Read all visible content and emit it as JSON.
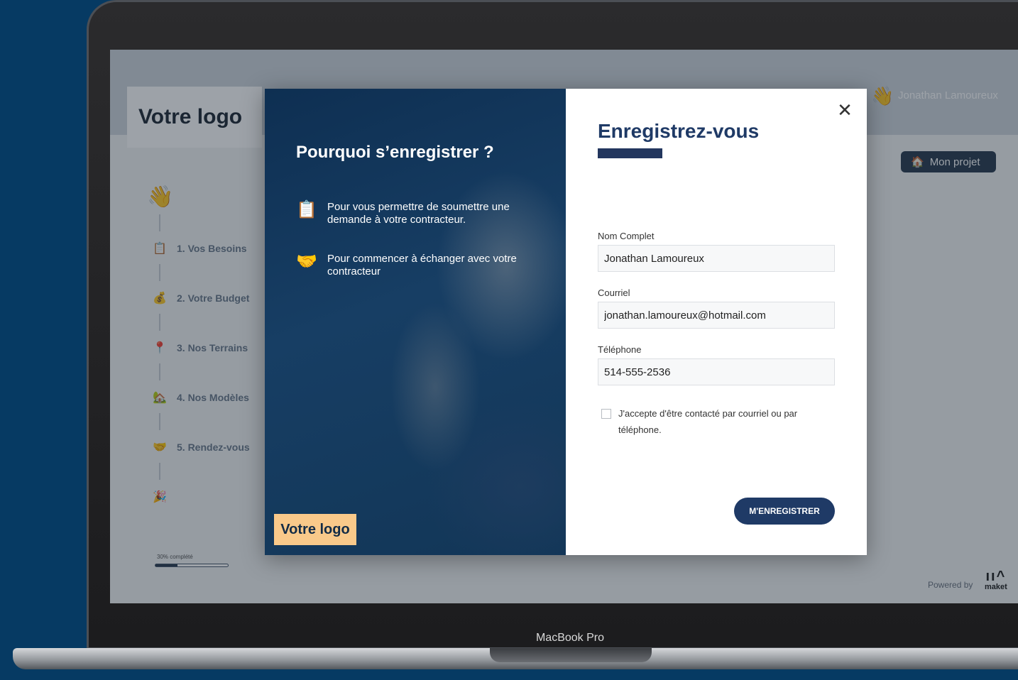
{
  "device": {
    "brand": "MacBook Pro"
  },
  "app": {
    "logo": "Votre logo",
    "user_name": "Jonathan Lamoureux",
    "project_button": "Mon projet",
    "steps": [
      {
        "label": "1. Vos Besoins",
        "icon": "clipboard-icon"
      },
      {
        "label": "2. Votre Budget",
        "icon": "money-bag-icon"
      },
      {
        "label": "3. Nos Terrains",
        "icon": "map-pin-icon"
      },
      {
        "label": "4. Nos Modèles",
        "icon": "house-icon"
      },
      {
        "label": "5. Rendez-vous",
        "icon": "handshake-icon"
      }
    ],
    "progress": {
      "label": "30% complété",
      "fraction": 0.3
    },
    "powered_by": "Powered by",
    "powered_brand": "maket"
  },
  "modal": {
    "left": {
      "heading": "Pourquoi s’enregistrer ?",
      "reasons": [
        {
          "icon": "clipboard-icon",
          "text": "Pour vous permettre de soumettre une demande à votre contracteur."
        },
        {
          "icon": "handshake-icon",
          "text": "Pour commencer à échanger avec votre contracteur"
        }
      ],
      "logo": "Votre logo"
    },
    "right": {
      "title": "Enregistrez-vous",
      "fields": {
        "name": {
          "label": "Nom Complet",
          "value": "Jonathan Lamoureux"
        },
        "email": {
          "label": "Courriel",
          "value": "jonathan.lamoureux@hotmail.com"
        },
        "phone": {
          "label": "Téléphone",
          "value": "514-555-2536"
        }
      },
      "consent": "J'accepte d'être contacté par courriel ou par téléphone.",
      "submit": "M'ENREGISTRER"
    }
  },
  "colors": {
    "page_bg": "#063a63",
    "brand_navy": "#1f3a66",
    "logo_badge": "#f9c98a"
  }
}
